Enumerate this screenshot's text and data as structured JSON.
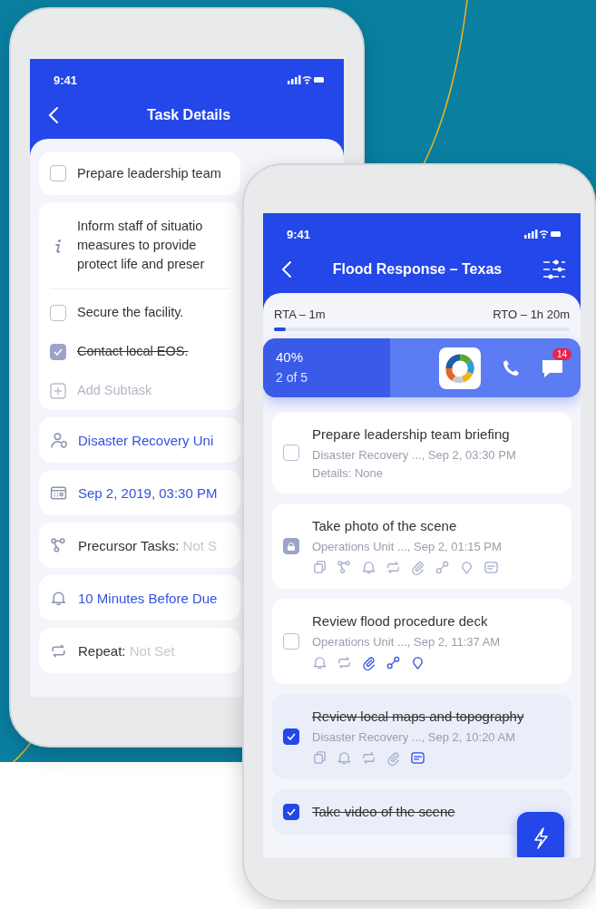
{
  "back_phone": {
    "status_time": "9:41",
    "title": "Task Details",
    "subtasks": [
      {
        "kind": "checkbox",
        "checked": false,
        "lines": [
          "Prepare leadership team"
        ]
      },
      {
        "kind": "info",
        "lines": [
          "Inform staff of situatio",
          "measures to provide",
          "protect life and preser"
        ]
      },
      {
        "kind": "checkbox",
        "checked": false,
        "lines": [
          "Secure the facility."
        ]
      },
      {
        "kind": "checkbox",
        "checked": true,
        "lines": [
          "Contact local EOS."
        ]
      },
      {
        "kind": "add",
        "lines": [
          "Add Subtask"
        ]
      }
    ],
    "fields": [
      {
        "kind": "team",
        "value": "Disaster Recovery Uni"
      },
      {
        "kind": "date",
        "value": "Sep 2, 2019, 03:30 PM"
      },
      {
        "kind": "precursor",
        "label": "Precursor Tasks:",
        "value": "Not S"
      },
      {
        "kind": "reminder",
        "value": "10 Minutes Before Due"
      },
      {
        "kind": "repeat",
        "label": "Repeat:",
        "value": "Not Set"
      }
    ]
  },
  "front_phone": {
    "status_time": "9:41",
    "title": "Flood Response – Texas",
    "rta": "RTA – 1m",
    "rto": "RTO – 1h 20m",
    "timer": {
      "level": 0.04
    },
    "progress": {
      "percent": "40%",
      "count": "2 of 5",
      "level": 0.4
    },
    "chat_badge": "14",
    "tasks": [
      {
        "kind": "checkbox",
        "checked": false,
        "title": "Prepare leadership team briefing",
        "meta": "Disaster Recovery ..., Sep 2, 03:30 PM",
        "details": "Details: None"
      },
      {
        "kind": "locked",
        "title": "Take photo of the scene",
        "meta": "Operations Unit ..., Sep 2, 01:15 PM",
        "icons": [
          {
            "kind": "copy",
            "active": false
          },
          {
            "kind": "branch",
            "active": false
          },
          {
            "kind": "bell",
            "active": false
          },
          {
            "kind": "repeat",
            "active": false
          },
          {
            "kind": "attach",
            "active": false
          },
          {
            "kind": "link",
            "active": false
          },
          {
            "kind": "pin",
            "active": false
          },
          {
            "kind": "note",
            "active": false
          }
        ]
      },
      {
        "kind": "checkbox",
        "checked": false,
        "title": "Review flood procedure deck",
        "meta": "Operations Unit ..., Sep 2, 11:37 AM",
        "icons": [
          {
            "kind": "bell",
            "active": false
          },
          {
            "kind": "repeat",
            "active": false
          },
          {
            "kind": "attach",
            "active": true
          },
          {
            "kind": "link",
            "active": true
          },
          {
            "kind": "pin",
            "active": true
          }
        ]
      },
      {
        "kind": "checkbox",
        "checked": true,
        "title": "Review local maps and topography",
        "meta": "Disaster Recovery ..., Sep 2, 10:20 AM",
        "icons": [
          {
            "kind": "copy",
            "active": false
          },
          {
            "kind": "bell",
            "active": false
          },
          {
            "kind": "repeat",
            "active": false
          },
          {
            "kind": "attach",
            "active": false
          },
          {
            "kind": "note",
            "active": true
          }
        ]
      },
      {
        "kind": "checkbox",
        "checked": true,
        "title": "Take video of the scene"
      }
    ]
  }
}
